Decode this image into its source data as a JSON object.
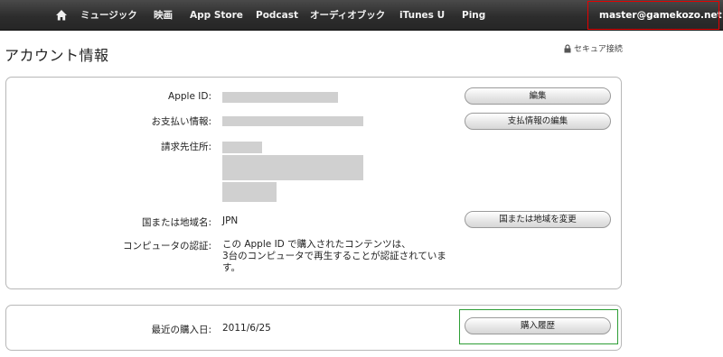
{
  "navbar": {
    "items": [
      "ミュージック",
      "映画",
      "App Store",
      "Podcast",
      "オーディオブック",
      "iTunes U",
      "Ping"
    ],
    "account_email": "master@gamekozo.net",
    "home_icon": "home-icon"
  },
  "header": {
    "title": "アカウント情報",
    "secure_label": "セキュア接続"
  },
  "account": {
    "apple_id_label": "Apple ID:",
    "payment_label": "お支払い情報:",
    "billing_label": "請求先住所:",
    "country_label": "国または地域名:",
    "country_value": "JPN",
    "auth_label": "コンピュータの認証:",
    "auth_lines": [
      "この Apple ID で購入されたコンテンツは、",
      "3台のコンピュータで再生することが認証されていま",
      "す。"
    ],
    "buttons": {
      "edit": "編集",
      "edit_payment": "支払情報の編集",
      "change_country": "国または地域を変更"
    }
  },
  "purchases": {
    "last_purchase_label": "最近の購入日:",
    "last_purchase_date": "2011/6/25",
    "history_button": "購入履歴"
  },
  "colors": {
    "navbar": "#333333",
    "account_highlight": "#e60000",
    "history_highlight": "#2e9e36"
  }
}
